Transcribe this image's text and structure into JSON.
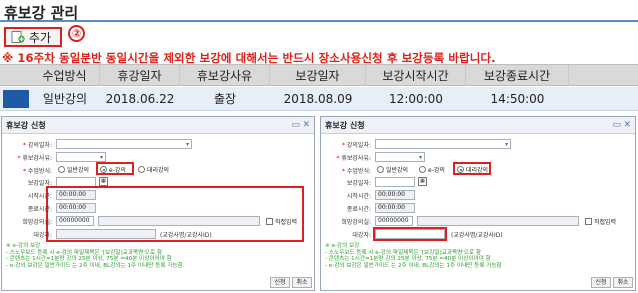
{
  "page": {
    "title": "휴보강 관리",
    "add_button": "추가",
    "step_marker": "②",
    "notice": "※ 16주차 동일분반 동일시간을 제외한 보강에 대해서는 반드시 장소사용신청 후 보강등록 바랍니다."
  },
  "grid": {
    "columns": [
      "수업방식",
      "휴강일자",
      "휴보강사유",
      "보강일자",
      "보강시작시간",
      "보강종료시간"
    ],
    "rows": [
      [
        "일반강의",
        "2018.06.22",
        "출장",
        "2018.08.09",
        "12:00:00",
        "14:50:00"
      ]
    ]
  },
  "dialog_left": {
    "title": "휴보강 신청",
    "labels": {
      "course": "강의일자:",
      "reason": "휴보강사유:",
      "method": "수업방식:",
      "makeup_date": "보강일자:",
      "start_time": "시작시간:",
      "end_time": "종료시간:",
      "room": "희망강의실:",
      "substitute": "대강자:"
    },
    "radios": [
      "일반강의",
      "e-강의",
      "대리강의"
    ],
    "selected_radio": 1,
    "start_time": "00:00:00",
    "end_time": "00:00:00",
    "room_code": "00000000",
    "direct_input": "직접입력",
    "hint": "(교강사명/교강사ID)",
    "notes": [
      "※ e-강의 보강",
      "- 스노우보드 등록 시 e-강의 파일제목은 '[보강일]교과목명'으로 함",
      "- 콘텐츠는 1시간=1분량 강의 25분 이상, 75분 =40분 이상이어야 함",
      "- e-강의 보강은 일반가이드 는 2주 이내, BL강의는 1주 이내만 등록 가능함"
    ],
    "apply_button": "신청",
    "cancel_button": "취소"
  },
  "dialog_right": {
    "title": "휴보강 신청",
    "labels": {
      "course": "강의일자:",
      "reason": "휴보강사유:",
      "method": "수업방식:",
      "makeup_date": "보강일자:",
      "start_time": "시작시간:",
      "end_time": "종료시간:",
      "room": "희망강의실:",
      "substitute": "대강자:"
    },
    "radios": [
      "일반강의",
      "e-강의",
      "대리강의"
    ],
    "selected_radio": 2,
    "start_time": "00:00:00",
    "end_time": "00:00:00",
    "room_code": "00000000",
    "direct_input": "직접입력",
    "hint": "(교강사명/교강사ID)",
    "notes": [
      "※ e-강의 보강",
      "- 스노우보드 등록 시 e-강의 파일제목은 '[보강일]교과목명'으로 함",
      "- 콘텐츠는 1시간=1분량 강의 25분 이상, 75분 =40분 이상이어야 함",
      "- e-강의 보강은 일반가이드 는 2주 이내, BL강의는 1주 이내만 등록 가능함"
    ],
    "apply_button": "신청",
    "cancel_button": "취소"
  },
  "colors": {
    "accent": "#e02020",
    "header_bar": "#5a8bc9",
    "selected_row": "#1f5aa8",
    "note_green": "#2a9a2a"
  }
}
